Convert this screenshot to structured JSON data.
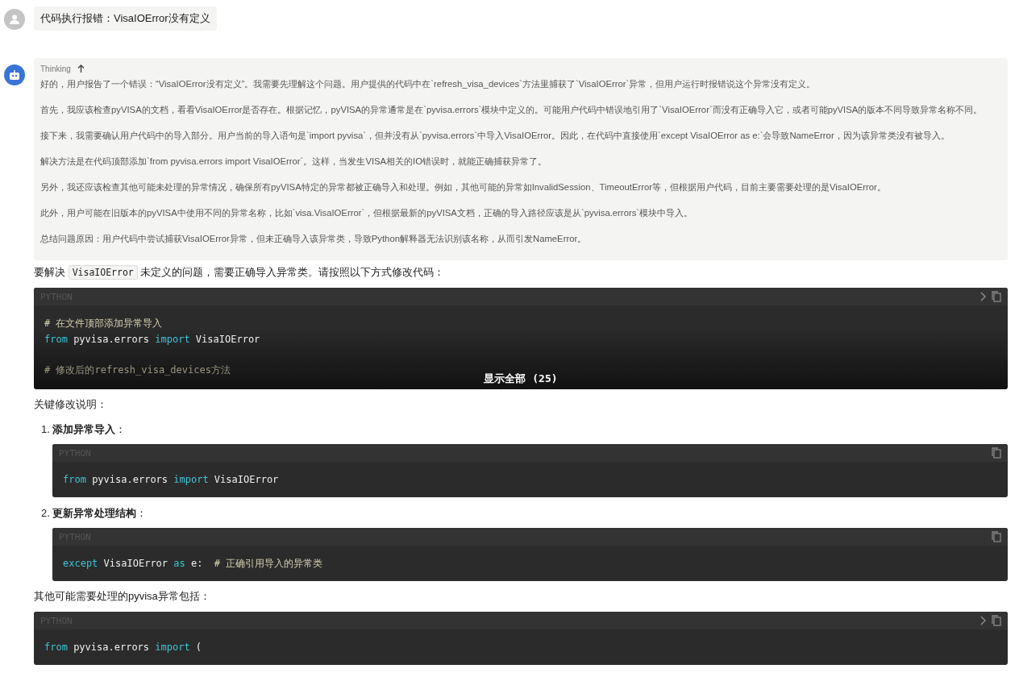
{
  "user_message": {
    "text": "代码执行报错：VisaIOError没有定义"
  },
  "assistant": {
    "thinking": {
      "label": "Thinking",
      "expanded": true,
      "paragraphs": [
        "好的，用户报告了一个错误：“VisaIOError没有定义”。我需要先理解这个问题。用户提供的代码中在`refresh_visa_devices`方法里捕获了`VisaIOError`异常，但用户运行时报错说这个异常没有定义。",
        "首先，我应该检查pyVISA的文档，看看VisaIOError是否存在。根据记忆，pyVISA的异常通常是在`pyvisa.errors`模块中定义的。可能用户代码中错误地引用了`VisaIOError`而没有正确导入它，或者可能pyVISA的版本不同导致异常名称不同。",
        "接下来，我需要确认用户代码中的导入部分。用户当前的导入语句是`import pyvisa`，但并没有从`pyvisa.errors`中导入VisaIOError。因此，在代码中直接使用`except VisaIOError as e:`会导致NameError，因为该异常类没有被导入。",
        "解决方法是在代码顶部添加`from pyvisa.errors import VisaIOError`。这样，当发生VISA相关的IO错误时，就能正确捕获异常了。",
        "另外，我还应该检查其他可能未处理的异常情况，确保所有pyVISA特定的异常都被正确导入和处理。例如，其他可能的异常如InvalidSession、TimeoutError等，但根据用户代码，目前主要需要处理的是VisaIOError。",
        "此外，用户可能在旧版本的pyVISA中使用不同的异常名称，比如`visa.VisaIOError`，但根据最新的pyVISA文档，正确的导入路径应该是从`pyvisa.errors`模块中导入。",
        "总结问题原因：用户代码中尝试捕获VisaIOError异常，但未正确导入该异常类，导致Python解释器无法识别该名称，从而引发NameError。"
      ]
    },
    "intro": [
      {
        "kind": "text",
        "text": "要解决 "
      },
      {
        "kind": "code",
        "text": "VisaIOError"
      },
      {
        "kind": "text",
        "text": " 未定义的问题，需要正确导入异常类。请按照以下方式修改代码："
      }
    ],
    "blocks": [
      {
        "kind": "code",
        "language": "PYTHON",
        "collapsible": true,
        "collapsed": true,
        "show_all": "显示全部 (25)",
        "lines": [
          {
            "kind": "code",
            "tokens": [
              {
                "kind": "comment",
                "text": "# 在文件顶部添加异常导入"
              }
            ]
          },
          {
            "kind": "code",
            "tokens": [
              {
                "kind": "keyword",
                "text": "from"
              },
              {
                "kind": "plain",
                "text": " pyvisa.errors "
              },
              {
                "kind": "keyword",
                "text": "import"
              },
              {
                "kind": "plain",
                "text": " VisaIOError"
              }
            ]
          },
          {
            "kind": "blank"
          },
          {
            "kind": "code",
            "tokens": [
              {
                "kind": "comment",
                "text": "# 修改后的refresh_visa_devices方法"
              }
            ]
          }
        ]
      },
      {
        "kind": "text",
        "text": "关键修改说明："
      },
      {
        "kind": "step",
        "number": "1.",
        "title": "添加异常导入",
        "suffix": "：",
        "code": {
          "language": "PYTHON",
          "collapsible": false,
          "lines": [
            {
              "kind": "code",
              "tokens": [
                {
                  "kind": "keyword",
                  "text": "from"
                },
                {
                  "kind": "plain",
                  "text": " pyvisa.errors "
                },
                {
                  "kind": "keyword",
                  "text": "import"
                },
                {
                  "kind": "plain",
                  "text": " VisaIOError"
                }
              ]
            }
          ]
        }
      },
      {
        "kind": "step",
        "number": "2.",
        "title": "更新异常处理结构",
        "suffix": "：",
        "code": {
          "language": "PYTHON",
          "collapsible": false,
          "lines": [
            {
              "kind": "code",
              "tokens": [
                {
                  "kind": "keyword",
                  "text": "except"
                },
                {
                  "kind": "plain",
                  "text": " VisaIOError "
                },
                {
                  "kind": "keyword",
                  "text": "as"
                },
                {
                  "kind": "plain",
                  "text": " e:  "
                },
                {
                  "kind": "comment",
                  "text": "# 正确引用导入的异常类"
                }
              ]
            }
          ]
        }
      },
      {
        "kind": "text",
        "text": "其他可能需要处理的pyvisa异常包括："
      },
      {
        "kind": "code",
        "language": "PYTHON",
        "collapsible": true,
        "lines": [
          {
            "kind": "code",
            "tokens": [
              {
                "kind": "keyword",
                "text": "from"
              },
              {
                "kind": "plain",
                "text": " pyvisa.errors "
              },
              {
                "kind": "keyword",
                "text": "import"
              },
              {
                "kind": "plain",
                "text": " ("
              }
            ]
          }
        ]
      }
    ]
  }
}
